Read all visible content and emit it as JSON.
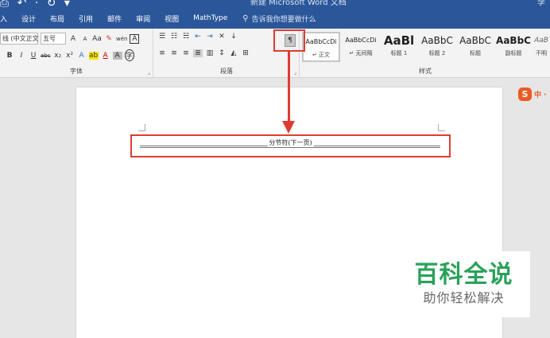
{
  "window": {
    "title": "新建 Microsoft Word 文档",
    "user": "李",
    "quick_access": "⎙ ↶ · ↻ ▾"
  },
  "ribbon_tabs": [
    {
      "label": "入"
    },
    {
      "label": "设计"
    },
    {
      "label": "布局"
    },
    {
      "label": "引用"
    },
    {
      "label": "邮件"
    },
    {
      "label": "审阅"
    },
    {
      "label": "视图"
    },
    {
      "label": "MathType"
    }
  ],
  "tell_me": {
    "placeholder": "告诉我你想要做什么"
  },
  "font_group": {
    "label": "字体",
    "font_name": "线 (中文正文",
    "font_size": "五号",
    "grow": "A",
    "shrink": "A",
    "change_case": "Aa",
    "clear_format": "✎",
    "phonetic": "wén",
    "char_border": "A",
    "bold": "B",
    "italic": "I",
    "underline": "U",
    "strike": "abc",
    "subscript": "x₂",
    "superscript": "x²",
    "text_effect": "A",
    "highlight": "ab",
    "font_color": "A",
    "char_shading": "A",
    "enclose": "字"
  },
  "paragraph_group": {
    "label": "段落",
    "show_marks": "¶"
  },
  "styles_group": {
    "label": "样式",
    "items": [
      {
        "preview": "AaBbCcDi",
        "name": "↵ 正文"
      },
      {
        "preview": "AaBbCcDi",
        "name": "↵ 无间隔"
      },
      {
        "preview": "AaBl",
        "name": "标题 1"
      },
      {
        "preview": "AaBbC",
        "name": "标题 2"
      },
      {
        "preview": "AaBbC",
        "name": "标题"
      },
      {
        "preview": "AaBbC",
        "name": "副标题"
      },
      {
        "preview": "AaB",
        "name": "不明"
      }
    ]
  },
  "document": {
    "section_break": "分节符(下一页)"
  },
  "ime": {
    "logo": "S",
    "mode": "中 ·"
  },
  "watermark": {
    "title": "百科全说",
    "subtitle": "助你轻松解决"
  },
  "colors": {
    "title_bar": "#2b579a",
    "highlight_red": "#e03b32",
    "watermark_green": "#2aa15a"
  }
}
